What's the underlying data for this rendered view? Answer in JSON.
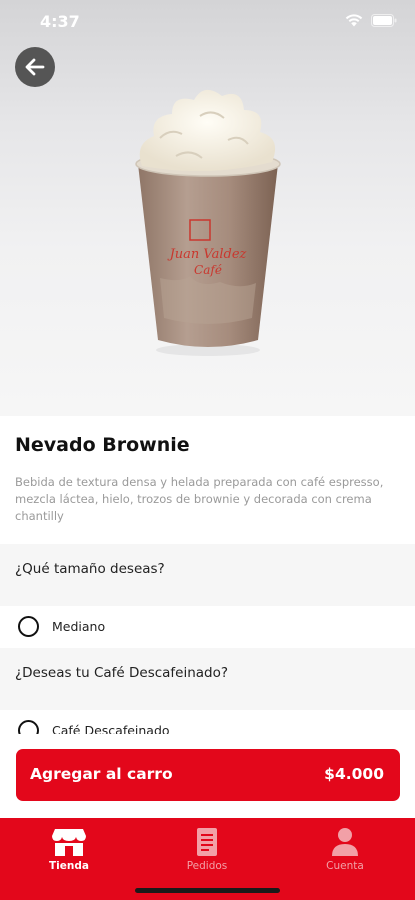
{
  "status": {
    "time": "4:37"
  },
  "product": {
    "name": "Nevado Brownie",
    "description": "Bebida de textura densa y helada preparada con café espresso, mezcla láctea, hielo, trozos de brownie y decorada con crema chantilly",
    "cup_brand": "Juan Valdez Café"
  },
  "sections": [
    {
      "question": "¿Qué tamaño deseas?",
      "option": "Mediano"
    },
    {
      "question": "¿Deseas tu  Café Descafeinado?",
      "option": "Café Descafeinado"
    }
  ],
  "cta": {
    "label": "Agregar al carro",
    "price": "$4.000"
  },
  "tabs": [
    {
      "label": "Tienda",
      "icon": "store-icon",
      "active": true
    },
    {
      "label": "Pedidos",
      "icon": "orders-icon",
      "active": false
    },
    {
      "label": "Cuenta",
      "icon": "account-icon",
      "active": false
    }
  ],
  "colors": {
    "brand_red": "#e3071b",
    "inactive_tab": "#f2a0a7"
  }
}
